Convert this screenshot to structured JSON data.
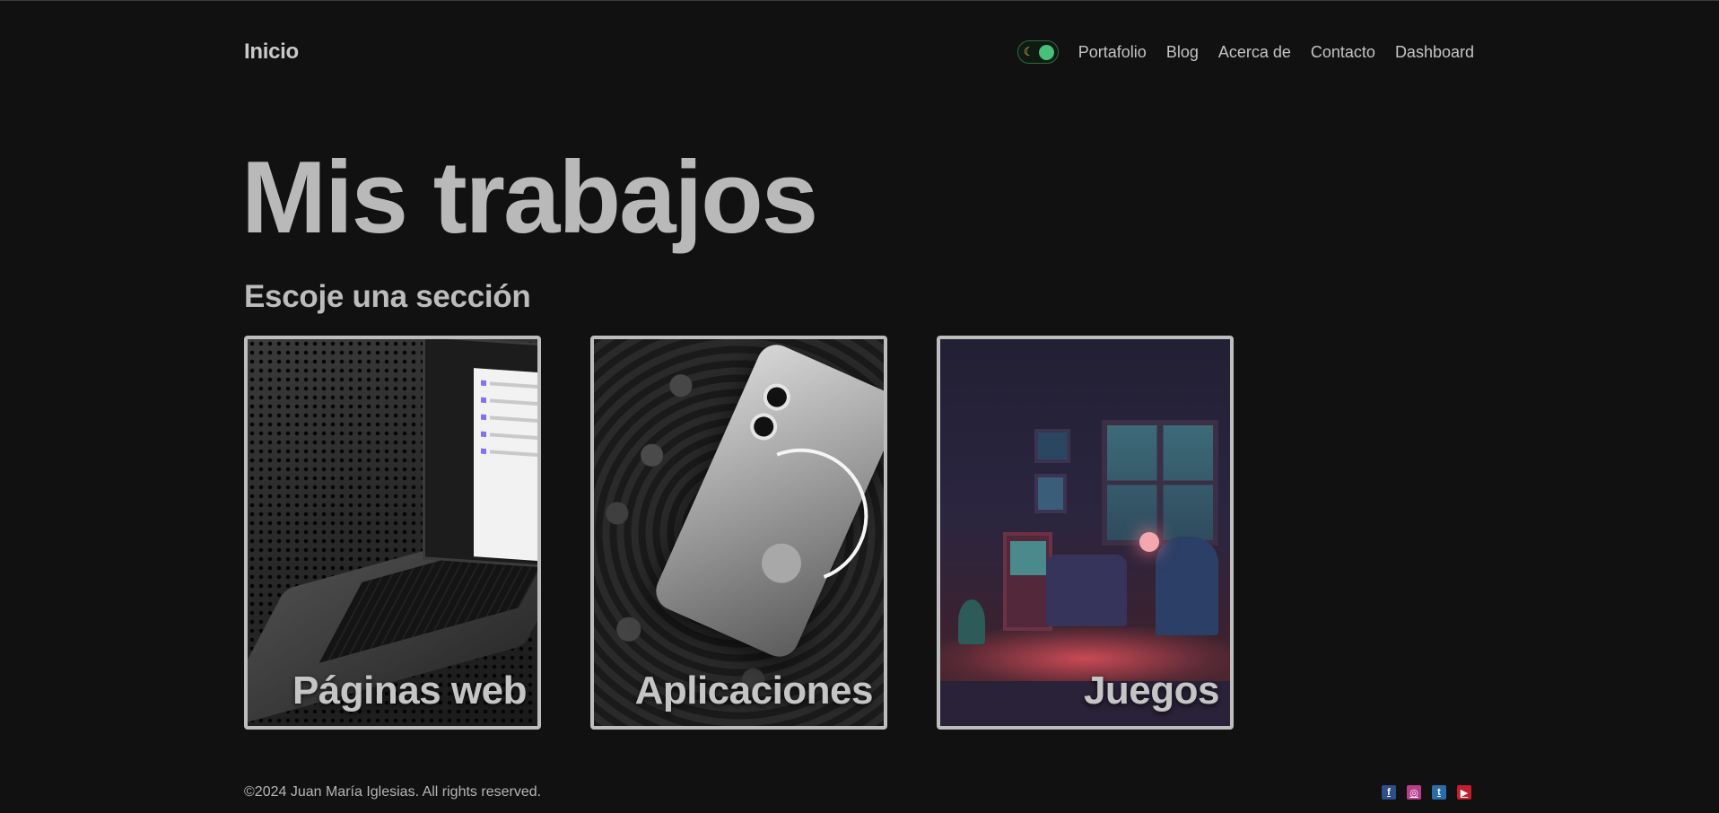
{
  "nav": {
    "brand": "Inicio",
    "theme_toggle_icon": "moon-icon",
    "links": [
      "Portafolio",
      "Blog",
      "Acerca de",
      "Contacto",
      "Dashboard"
    ]
  },
  "hero": {
    "title": "Mis trabajos",
    "subtitle": "Escoje una sección"
  },
  "cards": [
    {
      "label": "Páginas web",
      "image": "laptop-image"
    },
    {
      "label": "Aplicaciones",
      "image": "phone-image"
    },
    {
      "label": "Juegos",
      "image": "pixel-room-image"
    }
  ],
  "footer": {
    "copyright": "©2024 Juan María Iglesias. All rights reserved.",
    "socials": [
      {
        "icon": "facebook-icon",
        "glyph": "f",
        "color": "#2f4f8a"
      },
      {
        "icon": "instagram-icon",
        "glyph": "◎",
        "color": "#b63f8a"
      },
      {
        "icon": "twitter-icon",
        "glyph": "t",
        "color": "#2a6ea8"
      },
      {
        "icon": "youtube-icon",
        "glyph": "▶",
        "color": "#c21e2b"
      }
    ]
  },
  "colors": {
    "background": "#111111",
    "text": "#c4c4c4",
    "toggle_accent": "#47c07a"
  }
}
